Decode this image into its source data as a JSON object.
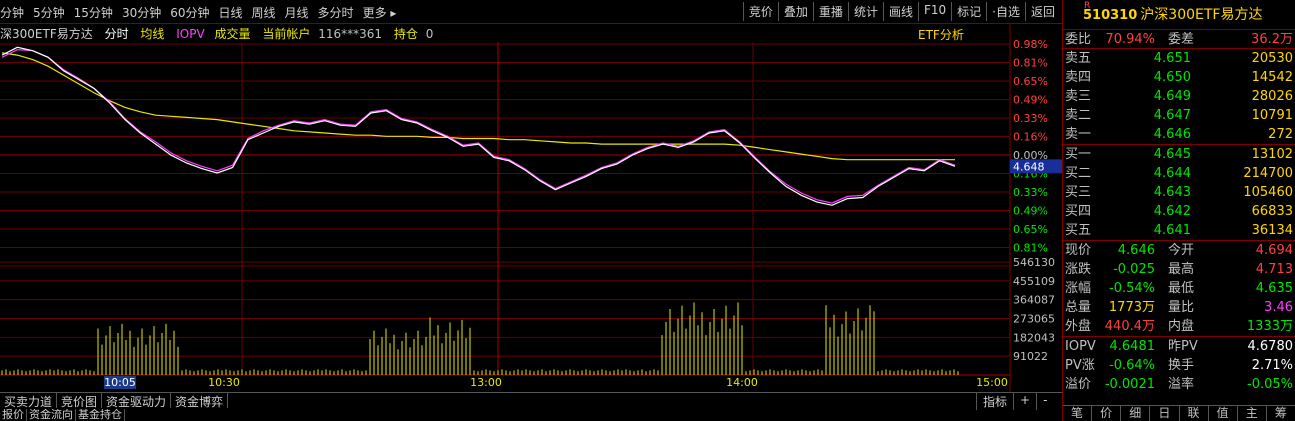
{
  "toolbar": {
    "periods": [
      "分钟",
      "5分钟",
      "15分钟",
      "30分钟",
      "60分钟",
      "日线",
      "周线",
      "月线",
      "多分时",
      "更多 ▸"
    ],
    "tools": [
      "竞价",
      "叠加",
      "重播",
      "统计",
      "画线",
      "F10",
      "标记",
      "·自选",
      "返回"
    ]
  },
  "infobar": {
    "name": "深300ETF易方达",
    "fenshi": "分时",
    "junxian": "均线",
    "iopv": "IOPV",
    "volume": "成交量",
    "account_label": "当前帐户",
    "account": "116***361",
    "position_label": "持仓",
    "position": "0",
    "etf_analysis": "ETF分析"
  },
  "chart_data": {
    "type": "line",
    "y_right_labels": [
      "0.98%",
      "0.81%",
      "0.65%",
      "0.49%",
      "0.33%",
      "0.16%",
      "0.00%",
      "0.16%",
      "0.33%",
      "0.49%",
      "0.65%",
      "0.81%"
    ],
    "current_price_marker": "4.648",
    "volume_axis_labels": [
      "546130",
      "455109",
      "364087",
      "273065",
      "182043",
      "91022"
    ],
    "x_labels": [
      "10:05",
      "10:30",
      "13:00",
      "14:00",
      "15:00"
    ],
    "pct_range": [
      -0.98,
      0.98
    ],
    "series": [
      {
        "role": "price",
        "color": "#ffffff",
        "values": [
          0.88,
          0.95,
          0.92,
          0.86,
          0.74,
          0.66,
          0.58,
          0.45,
          0.3,
          0.18,
          0.08,
          -0.02,
          -0.09,
          -0.14,
          -0.18,
          -0.13,
          0.12,
          0.18,
          0.24,
          0.28,
          0.26,
          0.29,
          0.25,
          0.24,
          0.36,
          0.38,
          0.3,
          0.27,
          0.2,
          0.14,
          0.06,
          0.08,
          -0.04,
          -0.07,
          -0.15,
          -0.25,
          -0.33,
          -0.27,
          -0.21,
          -0.14,
          -0.1,
          -0.02,
          0.04,
          0.08,
          0.05,
          0.1,
          0.18,
          0.2,
          0.09,
          -0.05,
          -0.18,
          -0.3,
          -0.38,
          -0.44,
          -0.47,
          -0.41,
          -0.4,
          -0.3,
          -0.22,
          -0.14,
          -0.16,
          -0.07,
          -0.12
        ]
      },
      {
        "role": "iopv",
        "color": "#ff40ff",
        "values": [
          0.86,
          0.93,
          0.92,
          0.86,
          0.75,
          0.67,
          0.58,
          0.46,
          0.31,
          0.19,
          0.1,
          0.0,
          -0.07,
          -0.12,
          -0.16,
          -0.11,
          0.13,
          0.2,
          0.25,
          0.29,
          0.27,
          0.3,
          0.26,
          0.25,
          0.37,
          0.39,
          0.31,
          0.28,
          0.21,
          0.15,
          0.07,
          0.09,
          -0.03,
          -0.06,
          -0.14,
          -0.24,
          -0.32,
          -0.26,
          -0.2,
          -0.13,
          -0.09,
          -0.01,
          0.05,
          0.09,
          0.06,
          0.11,
          0.19,
          0.21,
          0.1,
          -0.04,
          -0.17,
          -0.28,
          -0.36,
          -0.42,
          -0.45,
          -0.39,
          -0.38,
          -0.29,
          -0.21,
          -0.13,
          -0.15,
          -0.06,
          -0.11
        ]
      },
      {
        "role": "average",
        "color": "#e8e800",
        "values": [
          0.9,
          0.88,
          0.84,
          0.78,
          0.7,
          0.62,
          0.54,
          0.47,
          0.41,
          0.37,
          0.34,
          0.33,
          0.32,
          0.31,
          0.3,
          0.28,
          0.26,
          0.24,
          0.22,
          0.2,
          0.19,
          0.18,
          0.17,
          0.16,
          0.16,
          0.15,
          0.15,
          0.15,
          0.14,
          0.14,
          0.13,
          0.13,
          0.13,
          0.12,
          0.12,
          0.11,
          0.1,
          0.09,
          0.09,
          0.08,
          0.08,
          0.08,
          0.08,
          0.08,
          0.08,
          0.08,
          0.08,
          0.08,
          0.07,
          0.05,
          0.03,
          0.01,
          -0.01,
          -0.03,
          -0.05,
          -0.06,
          -0.06,
          -0.06,
          -0.06,
          -0.06,
          -0.06,
          -0.06,
          -0.06
        ]
      }
    ],
    "volumes": [
      0.05,
      0.06,
      0.04,
      0.05,
      0.06,
      0.05,
      0.04,
      0.05,
      0.06,
      0.05,
      0.04,
      0.05,
      0.06,
      0.05,
      0.06,
      0.05,
      0.04,
      0.05,
      0.06,
      0.04,
      0.05,
      0.06,
      0.05,
      0.04,
      0.05,
      0.06,
      0.05,
      0.04,
      0.05,
      0.06,
      0.05,
      0.04,
      0.05,
      0.06,
      0.05,
      0.06,
      0.05,
      0.04,
      0.05,
      0.06,
      0.04,
      0.05,
      0.06,
      0.05,
      0.04,
      0.05,
      0.06,
      0.05,
      0.04,
      0.05,
      0.06,
      0.05,
      0.04,
      0.05,
      0.06,
      0.05,
      0.06,
      0.05,
      0.04,
      0.05,
      0.06,
      0.04,
      0.05,
      0.06,
      0.05,
      0.04,
      0.05,
      0.06,
      0.05,
      0.04,
      0.05,
      0.06,
      0.05,
      0.04,
      0.05,
      0.06,
      0.05,
      0.04,
      0.05,
      0.06,
      0.05,
      0.06,
      0.05,
      0.04,
      0.05,
      0.06,
      0.04,
      0.05,
      0.06,
      0.05,
      0.04,
      0.05,
      0.06,
      0.05,
      0.04,
      0.05,
      0.06,
      0.05,
      0.04,
      0.05,
      0.06,
      0.05,
      0.04,
      0.05,
      0.06,
      0.05,
      0.06,
      0.05,
      0.04,
      0.05,
      0.06,
      0.04,
      0.05,
      0.06,
      0.05,
      0.04,
      0.05,
      0.06,
      0.05,
      0.04,
      0.05,
      0.06,
      0.05,
      0.04,
      0.05,
      0.06,
      0.05,
      0.04,
      0.05,
      0.06,
      0.05,
      0.06,
      0.05,
      0.04,
      0.05,
      0.06,
      0.04,
      0.05,
      0.06,
      0.05,
      0.04,
      0.05,
      0.06,
      0.05,
      0.04,
      0.05,
      0.06,
      0.05,
      0.04,
      0.05,
      0.06,
      0.05,
      0.04,
      0.05,
      0.06,
      0.05,
      0.06,
      0.05,
      0.04,
      0.05,
      0.06,
      0.04,
      0.05,
      0.06,
      0.05,
      0.04,
      0.05,
      0.06,
      0.05,
      0.04,
      0.05,
      0.06,
      0.05,
      0.04,
      0.05,
      0.06,
      0.05,
      0.04,
      0.05,
      0.06,
      0.05,
      0.06,
      0.05,
      0.04,
      0.05,
      0.06,
      0.04,
      0.05,
      0.06,
      0.05,
      0.04,
      0.05,
      0.06,
      0.05,
      0.04,
      0.05,
      0.06,
      0.05,
      0.04,
      0.05,
      0.06,
      0.05,
      0.04,
      0.05,
      0.06,
      0.05,
      0.06,
      0.05,
      0.04,
      0.05,
      0.06,
      0.04,
      0.05,
      0.06,
      0.05,
      0.04,
      0.05,
      0.06,
      0.05,
      0.04,
      0.05,
      0.06,
      0.05,
      0.04,
      0.05,
      0.06,
      0.05,
      0.04,
      0.05,
      0.06,
      0.05,
      0.06,
      0.05,
      0.04,
      0.05,
      0.06,
      0.04
    ],
    "volume_bursts": [
      {
        "from": 0.1,
        "to": 0.185,
        "value": 0.55
      },
      {
        "from": 0.38,
        "to": 0.445,
        "value": 0.5
      },
      {
        "from": 0.445,
        "to": 0.49,
        "value": 0.62
      },
      {
        "from": 0.685,
        "to": 0.775,
        "value": 0.78
      },
      {
        "from": 0.855,
        "to": 0.905,
        "value": 0.75
      },
      {
        "from": 0.905,
        "to": 0.91,
        "value": 1.0
      }
    ]
  },
  "bottom_tabs": [
    "买卖力道",
    "竞价图",
    "资金驱动力",
    "资金博弈"
  ],
  "bottom_tabs2": [
    "报价",
    "资金流向",
    "基金持仓"
  ],
  "bottom_right": [
    "指标",
    "+",
    "-"
  ],
  "quote": {
    "badge": "R",
    "code": "510310",
    "name": "沪深300ETF易方达",
    "weibi_label": "委比",
    "weibi": "70.94%",
    "weicha_label": "委差",
    "weicha": "36.2万",
    "asks": [
      {
        "label": "卖五",
        "price": "4.651",
        "vol": "20530"
      },
      {
        "label": "卖四",
        "price": "4.650",
        "vol": "14542"
      },
      {
        "label": "卖三",
        "price": "4.649",
        "vol": "28026"
      },
      {
        "label": "卖二",
        "price": "4.647",
        "vol": "10791"
      },
      {
        "label": "卖一",
        "price": "4.646",
        "vol": "272"
      }
    ],
    "bids": [
      {
        "label": "买一",
        "price": "4.645",
        "vol": "13102"
      },
      {
        "label": "买二",
        "price": "4.644",
        "vol": "214700"
      },
      {
        "label": "买三",
        "price": "4.643",
        "vol": "105460"
      },
      {
        "label": "买四",
        "price": "4.642",
        "vol": "66833"
      },
      {
        "label": "买五",
        "price": "4.641",
        "vol": "36134"
      }
    ],
    "stats": [
      {
        "l1": "现价",
        "v1": "4.646",
        "c1": "green",
        "l2": "今开",
        "v2": "4.694",
        "c2": "red"
      },
      {
        "l1": "涨跌",
        "v1": "-0.025",
        "c1": "green",
        "l2": "最高",
        "v2": "4.713",
        "c2": "red"
      },
      {
        "l1": "涨幅",
        "v1": "-0.54%",
        "c1": "green",
        "l2": "最低",
        "v2": "4.635",
        "c2": "green"
      },
      {
        "l1": "总量",
        "v1": "1773万",
        "c1": "yellow",
        "l2": "量比",
        "v2": "3.46",
        "c2": "magenta"
      },
      {
        "l1": "外盘",
        "v1": "440.4万",
        "c1": "red",
        "l2": "内盘",
        "v2": "1333万",
        "c2": "green"
      }
    ],
    "stats2": [
      {
        "l1": "IOPV",
        "v1": "4.6481",
        "c1": "green",
        "l2": "昨PV",
        "v2": "4.6780",
        "c2": "white"
      },
      {
        "l1": "PV涨",
        "v1": "-0.64%",
        "c1": "green",
        "l2": "换手",
        "v2": "2.71%",
        "c2": "white"
      },
      {
        "l1": "溢价",
        "v1": "-0.0021",
        "c1": "green",
        "l2": "溢率",
        "v2": "-0.05%",
        "c2": "green"
      }
    ],
    "tabs": [
      "笔",
      "价",
      "细",
      "日",
      "联",
      "值",
      "主",
      "筹"
    ]
  }
}
